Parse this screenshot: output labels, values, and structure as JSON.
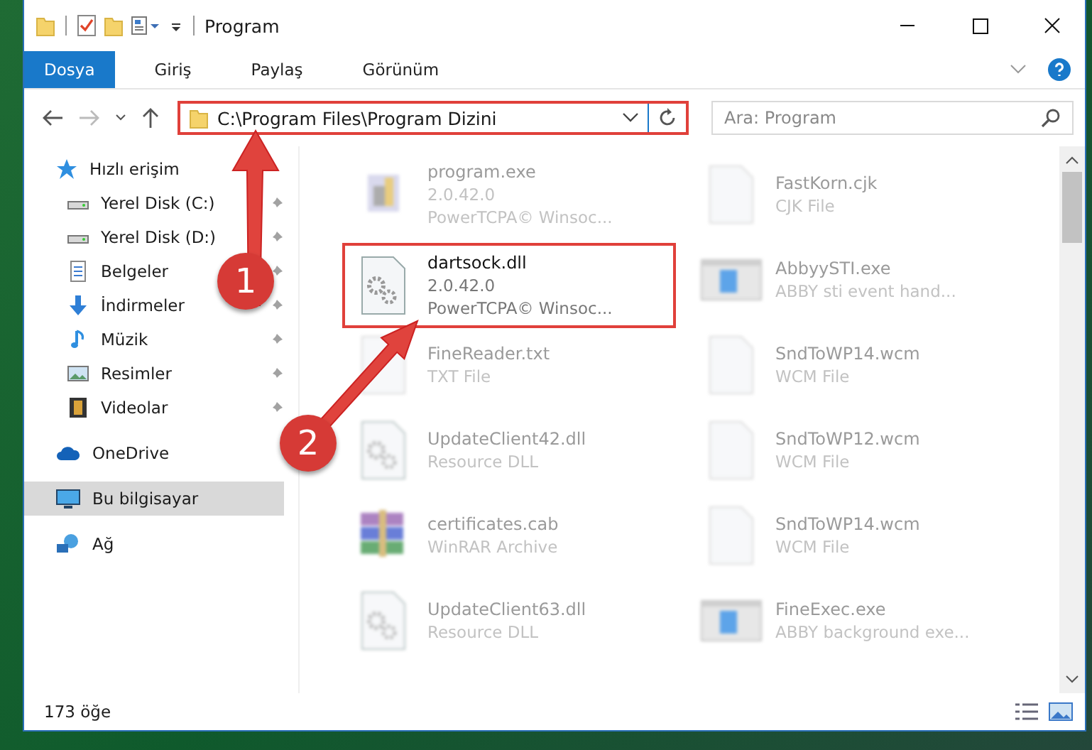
{
  "window": {
    "title": "Program"
  },
  "ribbon_tabs": [
    {
      "label": "Dosya",
      "selected": true
    },
    {
      "label": "Giriş",
      "selected": false
    },
    {
      "label": "Paylaş",
      "selected": false
    },
    {
      "label": "Görünüm",
      "selected": false
    }
  ],
  "address": {
    "value": "C:\\Program Files\\Program Dizini"
  },
  "search": {
    "placeholder": "Ara: Program"
  },
  "sidebar": {
    "items": [
      {
        "label": "Hızlı erişim",
        "kind": "star",
        "pinned": false,
        "selected": false,
        "children": [
          {
            "label": "Yerel Disk (C:)",
            "kind": "disk",
            "pinned": true,
            "selected": false
          },
          {
            "label": "Yerel Disk (D:)",
            "kind": "disk",
            "pinned": true,
            "selected": false
          },
          {
            "label": "Belgeler",
            "kind": "doc",
            "pinned": true,
            "selected": false
          },
          {
            "label": "İndirmeler",
            "kind": "download",
            "pinned": true,
            "selected": false
          },
          {
            "label": "Müzik",
            "kind": "music",
            "pinned": true,
            "selected": false
          },
          {
            "label": "Resimler",
            "kind": "image",
            "pinned": true,
            "selected": false
          },
          {
            "label": "Videolar",
            "kind": "video",
            "pinned": true,
            "selected": false
          }
        ]
      },
      {
        "label": "OneDrive",
        "kind": "cloud",
        "pinned": false,
        "selected": false
      },
      {
        "label": "Bu bilgisayar",
        "kind": "pc",
        "pinned": false,
        "selected": true
      },
      {
        "label": "Ağ",
        "kind": "network",
        "pinned": false,
        "selected": false
      }
    ]
  },
  "files": [
    {
      "name": "program.exe",
      "lines": [
        "2.0.42.0",
        "PowerTCPA© Winsoc..."
      ],
      "kind": "exe",
      "selected": false
    },
    {
      "name": "FastKorn.cjk",
      "lines": [
        "CJK File"
      ],
      "kind": "blank",
      "selected": false
    },
    {
      "name": "dartsock.dll",
      "lines": [
        "2.0.42.0",
        "PowerTCPA© Winsoc..."
      ],
      "kind": "dll",
      "selected": true
    },
    {
      "name": "AbbyySTI.exe",
      "lines": [
        "ABBY sti event hand..."
      ],
      "kind": "app",
      "selected": false
    },
    {
      "name": "FineReader.txt",
      "lines": [
        "TXT File"
      ],
      "kind": "blank",
      "selected": false
    },
    {
      "name": "SndToWP14.wcm",
      "lines": [
        "WCM File"
      ],
      "kind": "blank",
      "selected": false
    },
    {
      "name": "UpdateClient42.dll",
      "lines": [
        "Resource DLL"
      ],
      "kind": "dll",
      "selected": false
    },
    {
      "name": "SndToWP12.wcm",
      "lines": [
        "WCM File"
      ],
      "kind": "blank",
      "selected": false
    },
    {
      "name": "certificates.cab",
      "lines": [
        "WinRAR Archive"
      ],
      "kind": "cab",
      "selected": false
    },
    {
      "name": "SndToWP14.wcm",
      "lines": [
        "WCM File"
      ],
      "kind": "blank",
      "selected": false
    },
    {
      "name": "UpdateClient63.dll",
      "lines": [
        "Resource DLL"
      ],
      "kind": "dll",
      "selected": false
    },
    {
      "name": "FineExec.exe",
      "lines": [
        "ABBY background exe..."
      ],
      "kind": "app",
      "selected": false
    }
  ],
  "status_bar": {
    "count": "173 öğe"
  },
  "annotations": [
    {
      "label": "1"
    },
    {
      "label": "2"
    }
  ]
}
